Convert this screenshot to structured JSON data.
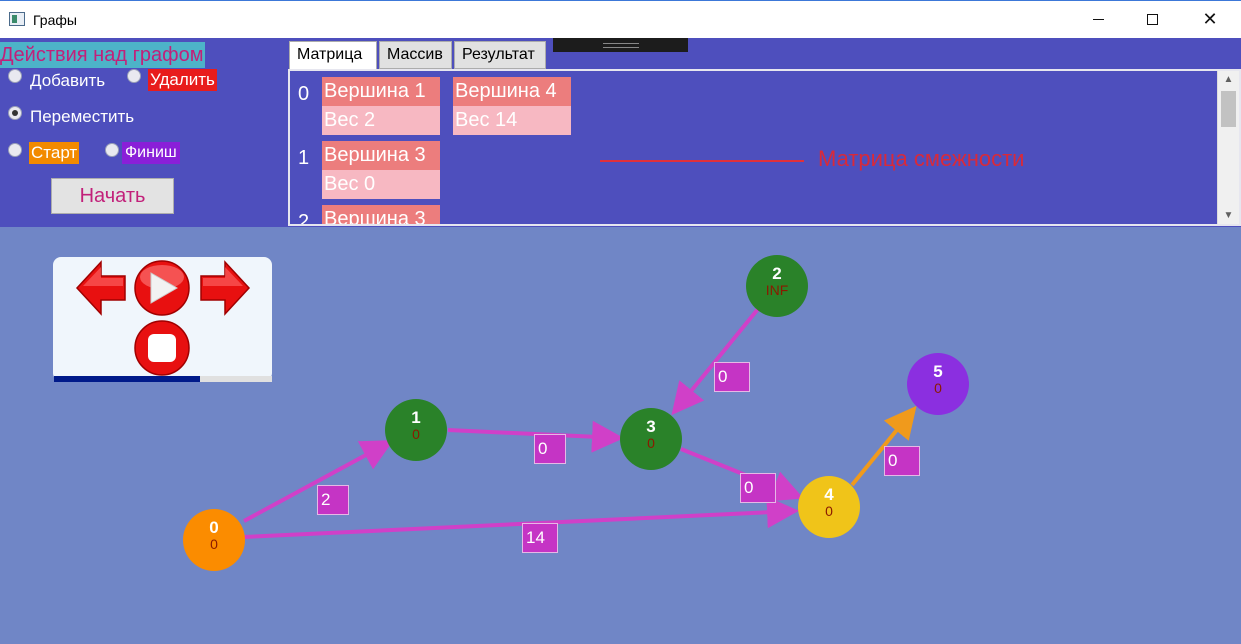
{
  "window": {
    "title": "Графы"
  },
  "actions": {
    "title": "Действия над графом",
    "add_label": "Добавить",
    "delete_label": "Удалить",
    "move_label": "Переместить",
    "start_label": "Старт",
    "finish_label": "Финиш",
    "selected": "move",
    "begin_button": "Начать"
  },
  "tabs": [
    {
      "label": "Матрица",
      "active": true
    },
    {
      "label": "Массив",
      "active": false
    },
    {
      "label": "Результат",
      "active": false
    }
  ],
  "matrix": {
    "rows": [
      {
        "index": "0",
        "cells": [
          {
            "vertex": "Вершина 1",
            "weight": "Вес 2"
          },
          {
            "vertex": "Вершина 4",
            "weight": "Вес 14"
          }
        ]
      },
      {
        "index": "1",
        "cells": [
          {
            "vertex": "Вершина 3",
            "weight": "Вес 0"
          }
        ]
      },
      {
        "index": "2",
        "cells": [
          {
            "vertex": "Вершина 3",
            "weight": ""
          }
        ]
      }
    ],
    "annotation": "Матрица смежности"
  },
  "player": {
    "progress": 0.67
  },
  "graph": {
    "nodes": [
      {
        "id": "0",
        "value": "0",
        "color": "#fb8c00"
      },
      {
        "id": "1",
        "value": "0",
        "color": "#2a8229"
      },
      {
        "id": "2",
        "value": "INF",
        "color": "#2a8229"
      },
      {
        "id": "3",
        "value": "0",
        "color": "#2a8229"
      },
      {
        "id": "4",
        "value": "0",
        "color": "#f0c419"
      },
      {
        "id": "5",
        "value": "0",
        "color": "#8b2fe0"
      }
    ],
    "edges": [
      {
        "from": "0",
        "to": "1",
        "weight": "2"
      },
      {
        "from": "0",
        "to": "4",
        "weight": "14"
      },
      {
        "from": "1",
        "to": "3",
        "weight": "0"
      },
      {
        "from": "2",
        "to": "3",
        "weight": "0"
      },
      {
        "from": "3",
        "to": "4",
        "weight": "0"
      },
      {
        "from": "4",
        "to": "5",
        "weight": "0"
      }
    ],
    "colors": {
      "edge": "#d040c8",
      "highlight_edge": "#f09a1c",
      "weight_bg": "#c534c5"
    }
  }
}
